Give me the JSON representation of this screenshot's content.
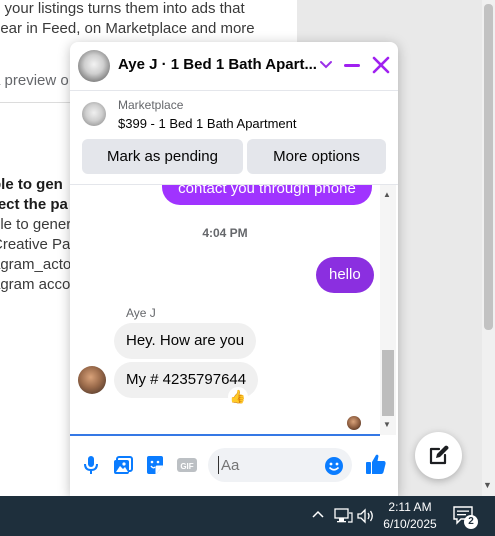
{
  "background": {
    "lines": [
      "g your listings turns them into ads that",
      "pear in Feed, on Marketplace and more",
      "a preview o",
      "ble to gen",
      "rect the pa",
      "ble to gener",
      "Creative Par",
      "agram_acto",
      "agram acco"
    ]
  },
  "chat": {
    "title": "Aye J · 1 Bed 1 Bath Apart...",
    "marketplace_label": "Marketplace",
    "listing": "$399 - 1 Bed 1 Bath Apartment",
    "buttons": {
      "pending": "Mark as pending",
      "more": "More options"
    },
    "messages": {
      "outgoing_partial": "contact you through phone",
      "timestamp": "4:04 PM",
      "outgoing_hello": "hello",
      "sender_name": "Aye J",
      "incoming_1": "Hey. How are you",
      "incoming_2": "My # 4235797644",
      "reaction": "👍"
    },
    "composer": {
      "placeholder": "Aa"
    },
    "colors": {
      "accent": "#a033ff",
      "like": "#0a7cff"
    }
  },
  "taskbar": {
    "time": "2:11 AM",
    "date": "6/10/2025",
    "notification_count": "2"
  }
}
